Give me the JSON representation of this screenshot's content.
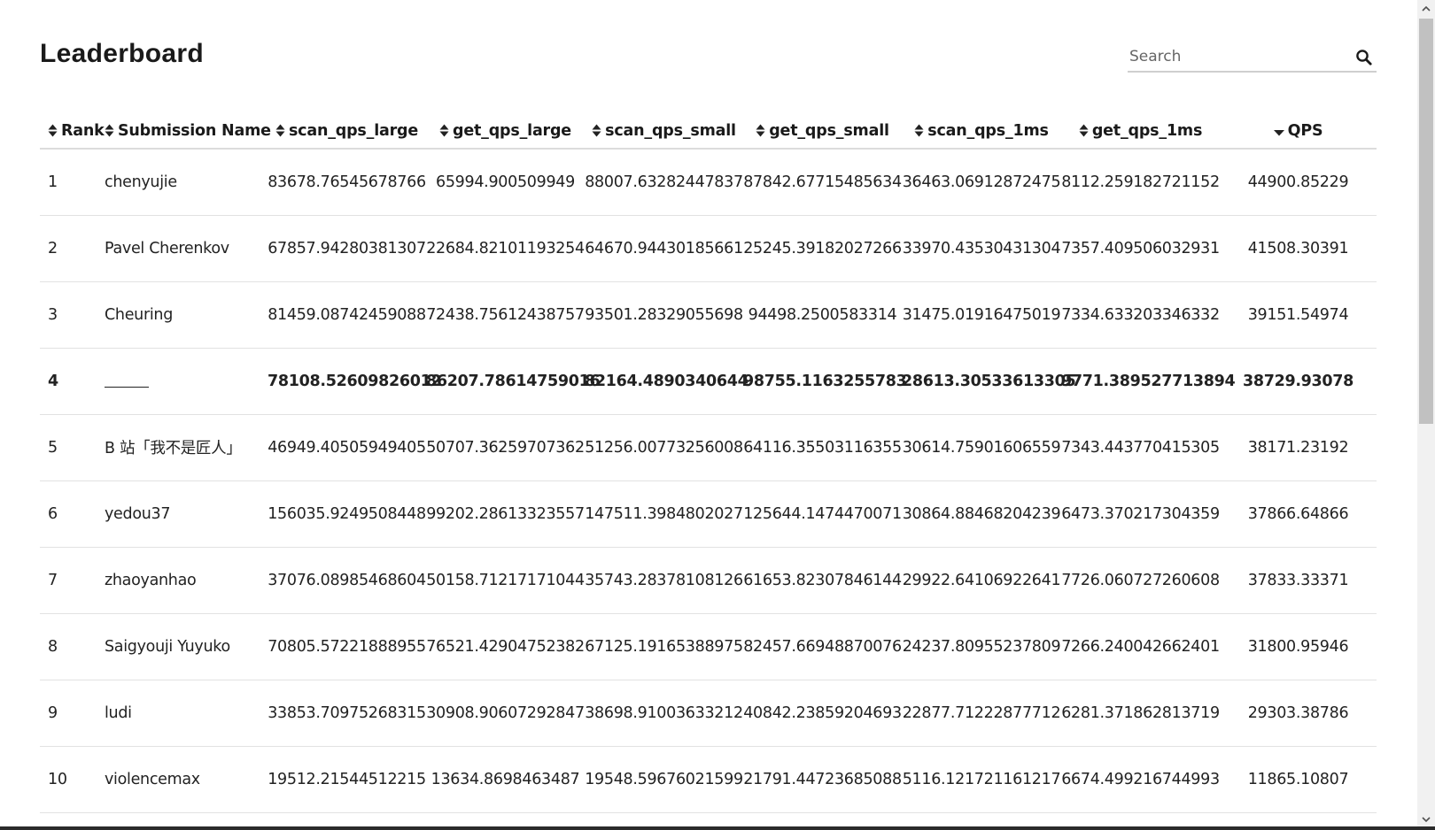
{
  "page": {
    "title": "Leaderboard"
  },
  "search": {
    "placeholder": "Search",
    "value": "",
    "icon": "search-icon"
  },
  "table": {
    "columns": [
      {
        "key": "rank",
        "label": "Rank",
        "sort": "both"
      },
      {
        "key": "name",
        "label": "Submission Name",
        "sort": "both"
      },
      {
        "key": "scan_qps_large",
        "label": "scan_qps_large",
        "sort": "both"
      },
      {
        "key": "get_qps_large",
        "label": "get_qps_large",
        "sort": "both"
      },
      {
        "key": "scan_qps_small",
        "label": "scan_qps_small",
        "sort": "both"
      },
      {
        "key": "get_qps_small",
        "label": "get_qps_small",
        "sort": "both"
      },
      {
        "key": "scan_qps_1ms",
        "label": "scan_qps_1ms",
        "sort": "both"
      },
      {
        "key": "get_qps_1ms",
        "label": "get_qps_1ms",
        "sort": "both"
      },
      {
        "key": "qps",
        "label": "QPS",
        "sort": "desc"
      }
    ],
    "rows": [
      {
        "rank": "1",
        "name": "chenyujie",
        "scan_qps_large": "83678.76545678766",
        "get_qps_large": "65994.900509949",
        "scan_qps_small": "88007.63282447837",
        "get_qps_small": "87842.67715485634",
        "scan_qps_1ms": "36463.06912872475",
        "get_qps_1ms": "8112.259182721152",
        "qps": "44900.85229",
        "bold": false
      },
      {
        "rank": "2",
        "name": "Pavel Cherenkov",
        "scan_qps_large": "67857.94280381307",
        "get_qps_large": "22684.82101193254",
        "scan_qps_small": "64670.94430185661",
        "get_qps_small": "25245.39182027266",
        "scan_qps_1ms": "33970.43530431304",
        "get_qps_1ms": "7357.409506032931",
        "qps": "41508.30391",
        "bold": false
      },
      {
        "rank": "3",
        "name": "Cheuring",
        "scan_qps_large": "81459.08742459088",
        "get_qps_large": "72438.75612438757",
        "scan_qps_small": "93501.28329055698",
        "get_qps_small": "94498.2500583314",
        "scan_qps_1ms": "31475.01916475019",
        "get_qps_1ms": "7334.633203346332",
        "qps": "39151.54974",
        "bold": false
      },
      {
        "rank": "4",
        "name": "",
        "scan_qps_large": "78108.52609826012",
        "get_qps_large": "86207.78614759016",
        "scan_qps_small": "82164.4890340644",
        "get_qps_small": "98755.1163255783",
        "scan_qps_1ms": "28613.30533613305",
        "get_qps_1ms": "9771.389527713894",
        "qps": "38729.93078",
        "bold": true
      },
      {
        "rank": "5",
        "name": "B 站「我不是匠人」",
        "scan_qps_large": "46949.40505949405",
        "get_qps_large": "50707.36259707362",
        "scan_qps_small": "51256.00773256008",
        "get_qps_small": "64116.35503116355",
        "scan_qps_1ms": "30614.75901606559",
        "get_qps_1ms": "7343.443770415305",
        "qps": "38171.23192",
        "bold": false
      },
      {
        "rank": "6",
        "name": "yedou37",
        "scan_qps_large": "156035.9249508448",
        "get_qps_large": "99202.28613323557",
        "scan_qps_small": "147511.3984802027",
        "get_qps_small": "125644.1474470071",
        "scan_qps_1ms": "30864.88468204239",
        "get_qps_1ms": "6473.370217304359",
        "qps": "37866.64866",
        "bold": false
      },
      {
        "rank": "7",
        "name": "zhaoyanhao",
        "scan_qps_large": "37076.08985468604",
        "get_qps_large": "50158.71217171044",
        "scan_qps_small": "35743.28378108126",
        "get_qps_small": "61653.82307846144",
        "scan_qps_1ms": "29922.64106922641",
        "get_qps_1ms": "7726.060727260608",
        "qps": "37833.33371",
        "bold": false
      },
      {
        "rank": "8",
        "name": "Saigyouji Yuyuko",
        "scan_qps_large": "70805.57221888955",
        "get_qps_large": "76521.42904752382",
        "scan_qps_small": "67125.19165388975",
        "get_qps_small": "82457.66948870076",
        "scan_qps_1ms": "24237.80955237809",
        "get_qps_1ms": "7266.240042662401",
        "qps": "31800.95946",
        "bold": false
      },
      {
        "rank": "9",
        "name": "ludi",
        "scan_qps_large": "33853.70975268315",
        "get_qps_large": "30908.90607292847",
        "scan_qps_small": "38698.91003633212",
        "get_qps_small": "40842.23859204693",
        "scan_qps_1ms": "22877.71222877712",
        "get_qps_1ms": "6281.371862813719",
        "qps": "29303.38786",
        "bold": false
      },
      {
        "rank": "10",
        "name": "violencemax",
        "scan_qps_large": "19512.21544512215",
        "get_qps_large": "13634.8698463487",
        "scan_qps_small": "19548.59676021599",
        "get_qps_small": "21791.44723685088",
        "scan_qps_1ms": "5116.121721161217",
        "get_qps_1ms": "6674.499216744993",
        "qps": "11865.10807",
        "bold": false
      }
    ]
  }
}
